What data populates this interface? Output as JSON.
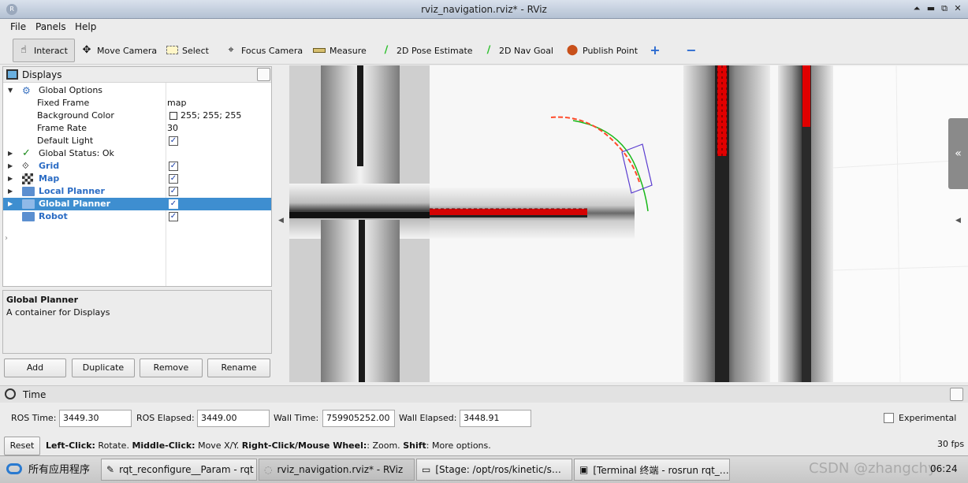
{
  "window": {
    "title": "rviz_navigation.rviz* - RViz",
    "app_icon": "rviz-icon"
  },
  "menu": [
    "File",
    "Panels",
    "Help"
  ],
  "toolbar": [
    {
      "label": "Interact",
      "icon": "interact-icon",
      "active": true
    },
    {
      "label": "Move Camera",
      "icon": "move-camera-icon"
    },
    {
      "label": "Select",
      "icon": "select-icon"
    },
    {
      "label": "Focus Camera",
      "icon": "focus-camera-icon"
    },
    {
      "label": "Measure",
      "icon": "measure-icon"
    },
    {
      "label": "2D Pose Estimate",
      "icon": "pose-estimate-icon"
    },
    {
      "label": "2D Nav Goal",
      "icon": "nav-goal-icon"
    },
    {
      "label": "Publish Point",
      "icon": "publish-point-icon"
    }
  ],
  "displays": {
    "title": "Displays",
    "rows": [
      {
        "label": "Global Options",
        "value": ""
      },
      {
        "label": "Fixed Frame",
        "value": "map"
      },
      {
        "label": "Background Color",
        "value": "255; 255; 255"
      },
      {
        "label": "Frame Rate",
        "value": "30"
      },
      {
        "label": "Default Light",
        "value": "✓"
      },
      {
        "label": "Global Status: Ok",
        "value": ""
      },
      {
        "label": "Grid",
        "value": "✓"
      },
      {
        "label": "Map",
        "value": "✓"
      },
      {
        "label": "Local Planner",
        "value": "✓"
      },
      {
        "label": "Global Planner",
        "value": "✓",
        "selected": true
      },
      {
        "label": "Robot",
        "value": "✓"
      }
    ]
  },
  "description": {
    "title": "Global Planner",
    "text": "A container for Displays"
  },
  "panel_buttons": [
    "Add",
    "Duplicate",
    "Remove",
    "Rename"
  ],
  "time": {
    "title": "Time",
    "ros_time_label": "ROS Time:",
    "ros_time": "3449.30",
    "ros_elapsed_label": "ROS Elapsed:",
    "ros_elapsed": "3449.00",
    "wall_time_label": "Wall Time:",
    "wall_time": "759905252.00",
    "wall_elapsed_label": "Wall Elapsed:",
    "wall_elapsed": "3448.91",
    "experimental": "Experimental"
  },
  "status": {
    "reset": "Reset",
    "hint_parts": [
      {
        "b": "Left-Click:",
        "t": " Rotate. "
      },
      {
        "b": "Middle-Click:",
        "t": " Move X/Y. "
      },
      {
        "b": "Right-Click/Mouse Wheel:",
        "t": ": Zoom. "
      },
      {
        "b": "Shift",
        "t": ": More options."
      }
    ],
    "fps": "30 fps"
  },
  "taskbar": {
    "apps": "所有应用程序",
    "items": [
      "rqt_reconfigure__Param - rqt",
      "rviz_navigation.rviz* - RViz",
      "[Stage: /opt/ros/kinetic/s…",
      "[Terminal 终端 - rosrun rqt_…"
    ],
    "watermark": "CSDN @zhangchy",
    "clock": "06:24"
  },
  "colors": {
    "selection": "#3e8ed0",
    "obstacle": "#e00000",
    "path": "#ff4a2a",
    "plan": "#18b818",
    "footprint": "#5a3cd0"
  }
}
